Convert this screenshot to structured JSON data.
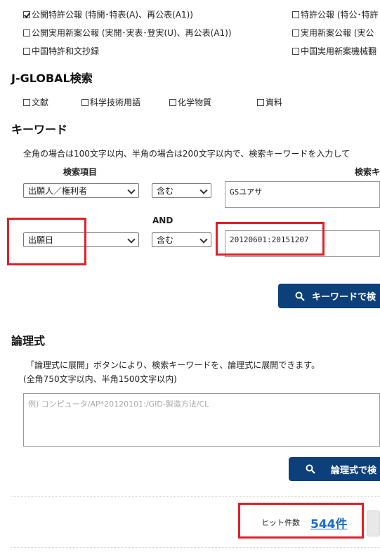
{
  "patent_types": {
    "row1_left": "公開特許公報 (特開･特表(A)、再公表(A1))",
    "row1_right": "特許公報 (特公･特許",
    "row2_left": "公開実用新案公報 (実開･実表･登実(U)、再公表(A1))",
    "row2_right": "実用新案公報 (実公",
    "row3_left": "中国特許和文抄録",
    "row3_right": "中国実用新案機械翻"
  },
  "jglobal": {
    "title": "J-GLOBAL検索",
    "options": [
      "文献",
      "科学技術用語",
      "化学物質",
      "資料"
    ]
  },
  "keyword": {
    "title": "キーワード",
    "description": "全角の場合は100文字以内、半角の場合は200文字以内で、検索キーワードを入力して",
    "col_item": "検索項目",
    "col_keyword": "検索キ",
    "row1": {
      "field": "出願人／権利者",
      "op": "含む",
      "value": "GSユアサ"
    },
    "connector": "AND",
    "row2": {
      "field": "出願日",
      "op": "含む",
      "value": "20120601:20151207"
    },
    "search_button": "キーワードで検"
  },
  "logic": {
    "title": "論理式",
    "desc1": "「論理式に展開」ボタンにより、検索キーワードを、論理式に展開できます。",
    "desc2": "(全角750文字以内、半角1500文字以内)",
    "placeholder": "例) コンピュータ/AP*20120101:/GID-製造方法/CL",
    "expand_button": "論理式で検"
  },
  "hits": {
    "label": "ヒット件数",
    "count": "544件"
  },
  "colors": {
    "button": "#0d3f7a",
    "highlight": "#e0202a",
    "link": "#1a6ccc"
  }
}
